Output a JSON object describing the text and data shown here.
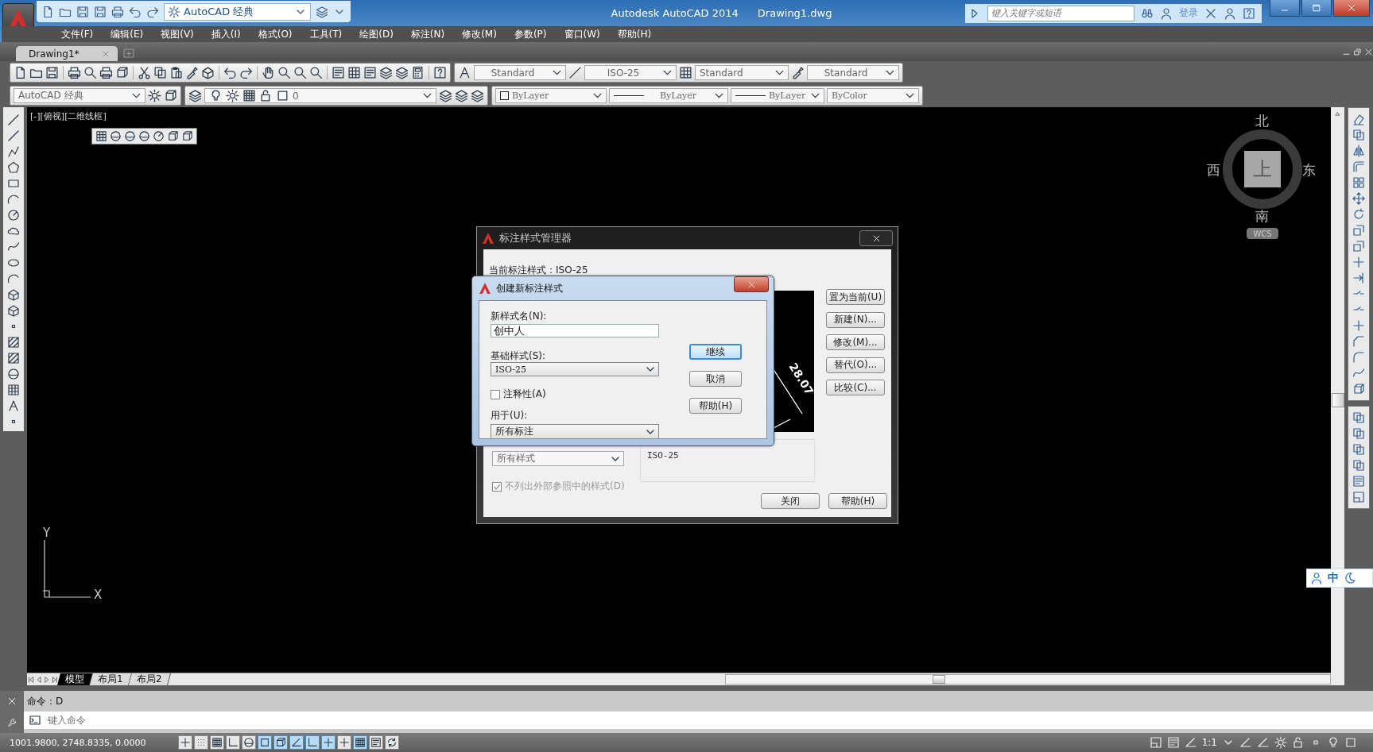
{
  "title_bar": {
    "workspace": "AutoCAD 经典",
    "app_title": "Autodesk AutoCAD 2014",
    "file_name": "Drawing1.dwg",
    "search_placeholder": "键入关键字或短语",
    "sign_in": "登录"
  },
  "menu_bar": [
    "文件(F)",
    "编辑(E)",
    "视图(V)",
    "插入(I)",
    "格式(O)",
    "工具(T)",
    "绘图(D)",
    "标注(N)",
    "修改(M)",
    "参数(P)",
    "窗口(W)",
    "帮助(H)"
  ],
  "document_tabs": [
    {
      "label": "Drawing1*",
      "selected": true
    }
  ],
  "styles_toolbar": {
    "text_style": "Standard",
    "dimension_style": "ISO-25",
    "table_style": "Standard",
    "multileader_style": "Standard"
  },
  "workspaces_toolbar": {
    "workspace": "AutoCAD 经典"
  },
  "layers_toolbar": {
    "layer": "0"
  },
  "properties_toolbar": {
    "color_property": "ByLayer",
    "linetype": "ByLayer",
    "lineweight": "ByLayer",
    "plot_style": "ByColor"
  },
  "viewport": {
    "label": "[-][俯视][二维线框]",
    "viewcube": {
      "north": "北",
      "east": "东",
      "south": "南",
      "west": "西",
      "face": "上",
      "ucs": "WCS"
    },
    "ucs_icon": {
      "x": "X",
      "y": "Y"
    }
  },
  "dimension_style_manager": {
    "title": "标注样式管理器",
    "current_style": "当前标注样式：ISO-25",
    "preview_value": "28.07",
    "buttons": [
      "置为当前(U)",
      "新建(N)...",
      "修改(M)...",
      "替代(O)...",
      "比较(C)..."
    ],
    "list_filter": "所有样式",
    "exclude_xrefs": {
      "label": "不列出外部参照中的样式(D)",
      "checked": true,
      "disabled": true
    },
    "description": "ISO-25",
    "close": "关闭",
    "help": "帮助(H)"
  },
  "create_style_dialog": {
    "title": "创建新标注样式",
    "name_label": "新样式名(N):",
    "name_value": "创中人",
    "base_label": "基础样式(S):",
    "base_value": "ISO-25",
    "annotative": {
      "label": "注释性(A)",
      "checked": false
    },
    "use_for_label": "用于(U):",
    "use_for_value": "所有标注",
    "buttons": [
      {
        "label": "继续",
        "default": true
      },
      {
        "label": "取消",
        "default": false
      },
      {
        "label": "帮助(H)",
        "default": false
      }
    ]
  },
  "layout_tabs": [
    {
      "label": "模型",
      "selected": true
    },
    {
      "label": "布局1",
      "selected": false
    },
    {
      "label": "布局2",
      "selected": false
    }
  ],
  "command_line": {
    "history": "命令：D",
    "placeholder": "键入命令"
  },
  "status_bar": {
    "coordinates": "1001.9800, 2748.8335, 0.0000",
    "toggles": [
      {
        "on": false
      },
      {
        "on": false
      },
      {
        "on": false
      },
      {
        "on": false
      },
      {
        "on": false
      },
      {
        "on": true
      },
      {
        "on": true
      },
      {
        "on": true
      },
      {
        "on": true
      },
      {
        "on": true
      },
      {
        "on": false
      },
      {
        "on": true
      },
      {
        "on": false
      },
      {
        "on": false
      }
    ],
    "annotation_scale": "1:1"
  },
  "ime_bar": {
    "language": "中"
  }
}
